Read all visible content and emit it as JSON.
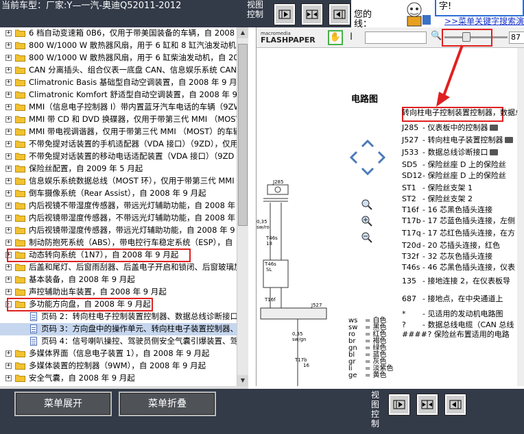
{
  "header": {
    "title": "当前车型：厂家:Y—一汽-奥迪Q52011-2012",
    "view_control_label": "视图控制",
    "promo_text1": "您的",
    "promo_text2": "线：",
    "promo_bubble": "字!",
    "promo_link": ">>菜单关键字搜索演示"
  },
  "tree": {
    "items": [
      {
        "text": "6 档自动变速箱 0B6，仅用于带美国装备的车辆，自 2008 年",
        "type": "folder",
        "exp": "+"
      },
      {
        "text": "800 W/1000 W 散热器风扇，用于 6 缸和 8 缸汽油发动机，",
        "type": "folder",
        "exp": "+"
      },
      {
        "text": "800 W/1000 W 散热器风扇，用于 6 缸柴油发动机，自 200",
        "type": "folder",
        "exp": "+"
      },
      {
        "text": "CAN 分离插头、组合仪表一底盘 CAN、信息娱乐系统 CAN、",
        "type": "folder",
        "exp": "+"
      },
      {
        "text": "Climatronic Basis 基础型自动空调装置，自 2008 年 9 月起",
        "type": "folder",
        "exp": "+"
      },
      {
        "text": "Climatronic Komfort 舒适型自动空调装置，自 2008 年 9 月",
        "type": "folder",
        "exp": "+"
      },
      {
        "text": "MMI（信息电子控制器 I）带内置蓝牙汽车电话的车辆（9ZW）",
        "type": "folder",
        "exp": "+"
      },
      {
        "text": "MMI 带 CD 和 DVD 换碟器，仅用于带第三代 MMI （MOST",
        "type": "folder",
        "exp": "+"
      },
      {
        "text": "MMI 带电视调谐器，仅用于带第三代 MMI （MOST）的车辆",
        "type": "folder",
        "exp": "+"
      },
      {
        "text": "不带免提对话装置的手机适配器（VDA 接口）（9ZD），仅用于",
        "type": "folder",
        "exp": "+"
      },
      {
        "text": "不带免提对话装置的移动电话适配装置（VDA 接口）（9ZD ）",
        "type": "folder",
        "exp": "+"
      },
      {
        "text": "保险丝配置，自 2009 年 5 月起",
        "type": "folder",
        "exp": "+"
      },
      {
        "text": "信息娱乐系统数据总线（MOST 环），仅用于带第三代 MMI",
        "type": "folder",
        "exp": "+"
      },
      {
        "text": "倒车摄像系统（Rear Assist），自 2008 年 9 月起",
        "type": "folder",
        "exp": "+"
      },
      {
        "text": "内后视镜不带湿度传感器，带远光灯辅助功能，自 2008 年 9",
        "type": "folder",
        "exp": "+"
      },
      {
        "text": "内后视镜带湿度传感器，不带远光灯辅助功能，自 2008 年 9",
        "type": "folder",
        "exp": "+"
      },
      {
        "text": "内后视镜带湿度传感器，带远光灯辅助功能，自 2008 年 9 月",
        "type": "folder",
        "exp": "+"
      },
      {
        "text": "制动防抱死系统（ABS），带电控行车稳定系统（ESP），自",
        "type": "folder",
        "exp": "+"
      },
      {
        "text": "动态转向系统（1N7），自 2008 年 9 月起",
        "type": "folder",
        "exp": "+"
      },
      {
        "text": "后盖和尾灯、后窗雨刮器、后盖电子开启和锁闭、后窗玻璃加",
        "type": "folder",
        "exp": "+"
      },
      {
        "text": "基本装备，自 2008 年 9 月起",
        "type": "folder",
        "exp": "+"
      },
      {
        "text": "声控辅助出车装置，自 2008 年 9 月起",
        "type": "folder",
        "exp": "+"
      },
      {
        "text": "多功能方向盘，自 2008 年 9 月起",
        "type": "folder",
        "exp": "-"
      },
      {
        "text": "页码 2：转向柱电子控制装置控制器、数据总线诊断接口、",
        "type": "doc"
      },
      {
        "text": "页码 3：方向盘中的操作单元、转向柱电子装置控制器、卷",
        "type": "doc",
        "selected": true
      },
      {
        "text": "页码 4：信号喇叭操控、驾驶员侧安全气囊引爆装置、驾驶",
        "type": "doc"
      },
      {
        "text": "多媒体界面（信息电子装置 1），自 2008 年 9 月起",
        "type": "folder",
        "exp": "+"
      },
      {
        "text": "多媒体装置的控制器（9WM），自 2008 年 9 月起",
        "type": "folder",
        "exp": "+"
      },
      {
        "text": "安全气囊，自 2008 年 9 月起",
        "type": "folder",
        "exp": "+"
      }
    ]
  },
  "viewer": {
    "logo_top": "macromedia",
    "logo_bottom": "FLASHPAPER",
    "zoom_value": "87",
    "zoom_level": 0.33,
    "page_heading": "电路图",
    "highlight_text": "转向柱电子控制装置控制器",
    "highlight_suffix": "，数据总",
    "component_rows": [
      {
        "code": "J285",
        "desc": "- 仪表板中的控制器",
        "cam": true
      },
      {
        "code": "J527",
        "desc": "- 转向柱电子装置控制器",
        "cam": true
      },
      {
        "code": "J533",
        "desc": "- 数据总线诊断接口",
        "cam": true
      },
      {
        "code": "SD5",
        "desc": "- 保险丝座 D 上的保险丝"
      },
      {
        "code": "SD12",
        "desc": "- 保险丝座 D 上的保险丝"
      },
      {
        "code": "ST1",
        "desc": "- 保险丝支架 1"
      },
      {
        "code": "ST2",
        "desc": "- 保险丝支架 2"
      },
      {
        "code": "T16f",
        "desc": "- 16 芯黑色插头连接"
      },
      {
        "code": "T17b",
        "desc": "- 17 芯蓝色插头连接，左侧"
      },
      {
        "code": "T17q",
        "desc": "- 17 芯红色插头连接，在方"
      },
      {
        "code": "T20d",
        "desc": "- 20 芯插头连接，红色"
      },
      {
        "code": "T32f",
        "desc": "- 32 芯灰色插头连接"
      },
      {
        "code": "T46s",
        "desc": "- 46 芯黑色插头连接，仪表"
      },
      {
        "code": "135",
        "desc": "- 接地连接 2，在仪表板导"
      },
      {
        "code": "687",
        "desc": "- 接地点，在中央通道上"
      },
      {
        "code": "*",
        "desc": "- 见适用的发动机电路图"
      },
      {
        "code": "?",
        "desc": "- 数据总线电缆（CAN 总线"
      },
      {
        "code": "####",
        "desc": "- ? 保险丝布置适用的电路"
      }
    ],
    "diagram_labels": {
      "j285": "J285",
      "j527": "J527",
      "wire_a": "0,35",
      "wire_b": "sw/ro",
      "t46s_a": "T46s",
      "t46s_b": "18",
      "t17b": "T17b",
      "t17b_pin": "16",
      "t32f": "T32f",
      "t32f_pin": "28",
      "t46_2": "T46s",
      "t46_2_pin": "SL",
      "t16f": "T16f",
      "wire_c": "0,35",
      "wire_d": "sw/gn"
    },
    "legend": [
      {
        "code": "ws",
        "name": "= 白色"
      },
      {
        "code": "sw",
        "name": "= 黑色"
      },
      {
        "code": "ro",
        "name": "= 红色"
      },
      {
        "code": "br",
        "name": "= 褐色"
      },
      {
        "code": "gn",
        "name": "= 绿色"
      },
      {
        "code": "bl",
        "name": "= 蓝色"
      },
      {
        "code": "gr",
        "name": "= 灰色"
      },
      {
        "code": "li",
        "name": "= 淡紫色"
      },
      {
        "code": "ge",
        "name": "= 黄色"
      }
    ]
  },
  "bottom": {
    "expand_label": "菜单展开",
    "collapse_label": "菜单折叠",
    "view_control_label": "视图控制"
  },
  "colors": {
    "bar_bg": "#333a48",
    "highlight": "#e02020",
    "folder": "#f2c231",
    "link": "#1230c8"
  }
}
